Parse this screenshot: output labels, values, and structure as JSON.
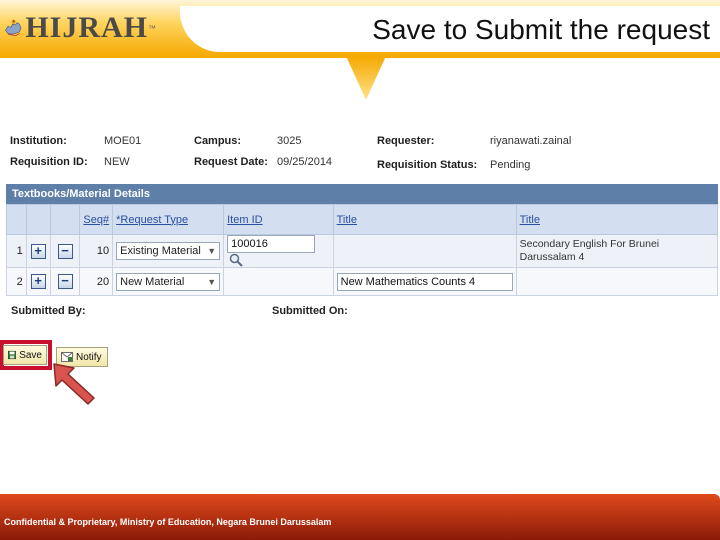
{
  "slide": {
    "title": "Save to Submit the request",
    "logo_text": "HIJRAH",
    "logo_tm": "™",
    "footer_text": "Confidential & Proprietary, Ministry of Education, Negara Brunei Darussalam"
  },
  "header_fields": {
    "institution_label": "Institution:",
    "institution_value": "MOE01",
    "campus_label": "Campus:",
    "campus_value": "3025",
    "requester_label": "Requester:",
    "requester_value": "riyanawati.zainal",
    "requisition_id_label": "Requisition ID:",
    "requisition_id_value": "NEW",
    "request_date_label": "Request Date:",
    "request_date_value": "09/25/2014",
    "requisition_status_label": "Requisition Status:",
    "requisition_status_value": "Pending"
  },
  "grid": {
    "title": "Textbooks/Material Details",
    "columns": {
      "seq": "Seq#",
      "request_type": "*Request Type",
      "item_id": "Item ID",
      "title_input": "Title",
      "title_display": "Title"
    },
    "rows": [
      {
        "row_num": "1",
        "add": "+",
        "remove": "−",
        "seq": "10",
        "request_type": "Existing Material",
        "item_id": "100016",
        "title_input": "",
        "title_display": "Secondary English For Brunei Darussalam 4"
      },
      {
        "row_num": "2",
        "add": "+",
        "remove": "−",
        "seq": "20",
        "request_type": "New Material",
        "item_id": "",
        "title_input": "New Mathematics Counts 4",
        "title_display": ""
      }
    ]
  },
  "submitted": {
    "by_label": "Submitted By:",
    "on_label": "Submitted On:"
  },
  "toolbar": {
    "save_label": "Save",
    "notify_label": "Notify"
  },
  "colors": {
    "highlight": "#c8102e",
    "grid_header": "#5e7fa8",
    "footer": "#c23a13",
    "arrow": "#d9534f"
  }
}
